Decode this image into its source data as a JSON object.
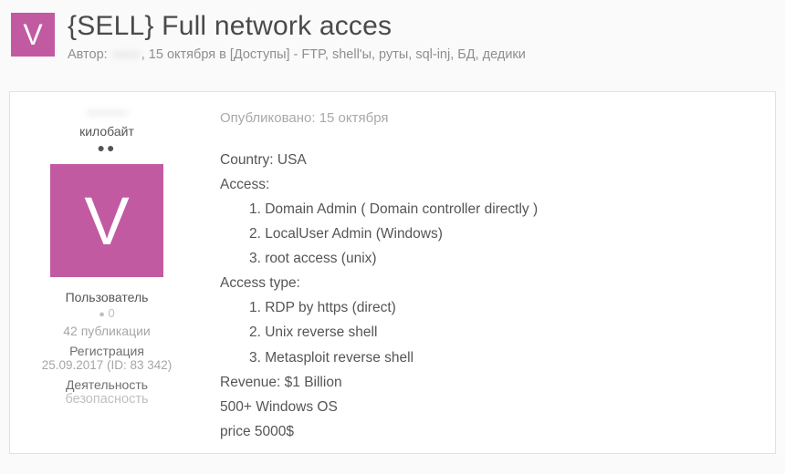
{
  "header": {
    "avatar_letter": "V",
    "thread_title": "{SELL} Full network acces",
    "byline": {
      "author_label": "Автор:",
      "author_masked": "——",
      "date_sep": ", ",
      "date": "15 октября",
      "in_label": " в ",
      "forum_prefix": "[Доступы]",
      "forum_rest": " - FTP, shell'ы, руты, sql-inj, БД, дедики"
    }
  },
  "sidebar": {
    "username_masked": "———",
    "rank": "килобайт",
    "pips": "●●",
    "avatar_letter": "V",
    "role": "Пользователь",
    "rep_dot": "●",
    "rep_value": " 0",
    "pubs": "42 публикации",
    "reg_label": "Регистрация",
    "reg_value": "25.09.2017 (ID: 83 342)",
    "activity_label": "Деятельность",
    "activity_value": "безопасность"
  },
  "content": {
    "posted_label": "Опубликовано: ",
    "posted_date": "15 октября",
    "body": {
      "country": "Country: USA",
      "access_label": "Access:",
      "access_items": [
        "1. Domain Admin  ( Domain controller directly )",
        "2. LocalUser Admin  (Windows)",
        "3. root access (unix)"
      ],
      "access_type_label": "Access type:",
      "access_type_items": [
        "1. RDP by https (direct)",
        "2. Unix reverse shell",
        "3. Metasploit reverse shell"
      ],
      "revenue": "Revenue: $1 Billion",
      "os": "500+ Windows OS",
      "price": "price 5000$"
    }
  }
}
